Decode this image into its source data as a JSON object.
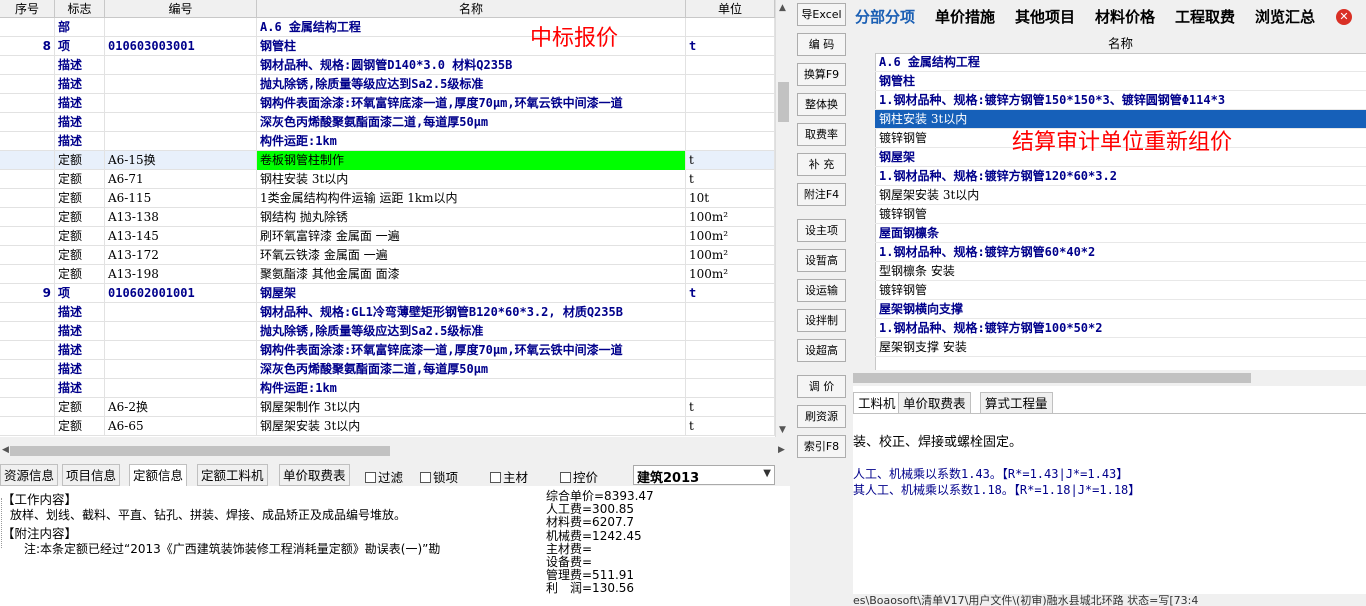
{
  "left": {
    "headers": {
      "seq": "序号",
      "flag": "标志",
      "code": "编号",
      "name": "名称",
      "unit": "单位"
    },
    "rows": [
      {
        "seq": "",
        "flag": "部",
        "code": "",
        "name": "A.6 金属结构工程",
        "unit": "",
        "style": "bold-blue"
      },
      {
        "seq": "8",
        "flag": "项",
        "code": "010603003001",
        "name": "钢管柱",
        "unit": "t",
        "style": "bold-blue"
      },
      {
        "seq": "",
        "flag": "描述",
        "code": "",
        "name": "钢材品种、规格:圆钢管D140*3.0 材料Q235B",
        "unit": "",
        "style": "bold-blue"
      },
      {
        "seq": "",
        "flag": "描述",
        "code": "",
        "name": "抛丸除锈,除质量等级应达到Sa2.5级标准",
        "unit": "",
        "style": "bold-blue"
      },
      {
        "seq": "",
        "flag": "描述",
        "code": "",
        "name": "钢构件表面涂漆:环氧富锌底漆一道,厚度70μm,环氧云铁中间漆一道",
        "unit": "",
        "style": "bold-blue"
      },
      {
        "seq": "",
        "flag": "描述",
        "code": "",
        "name": "深灰色丙烯酸聚氨酯面漆二道,每道厚50μm",
        "unit": "",
        "style": "bold-blue"
      },
      {
        "seq": "",
        "flag": "描述",
        "code": "",
        "name": "构件运距:1km",
        "unit": "",
        "style": "bold-blue"
      },
      {
        "seq": "",
        "flag": "定额",
        "code": "A6-15换",
        "name": "卷板钢管柱制作",
        "unit": "t",
        "style": "selected"
      },
      {
        "seq": "",
        "flag": "定额",
        "code": "A6-71",
        "name": "钢柱安装 3t以内",
        "unit": "t",
        "style": "normal"
      },
      {
        "seq": "",
        "flag": "定额",
        "code": "A6-115",
        "name": "1类金属结构构件运输 运距 1km以内",
        "unit": "10t",
        "style": "normal"
      },
      {
        "seq": "",
        "flag": "定额",
        "code": "A13-138",
        "name": "钢结构 抛丸除锈",
        "unit": "100m²",
        "style": "normal"
      },
      {
        "seq": "",
        "flag": "定额",
        "code": "A13-145",
        "name": "刷环氧富锌漆 金属面 一遍",
        "unit": "100m²",
        "style": "normal"
      },
      {
        "seq": "",
        "flag": "定额",
        "code": "A13-172",
        "name": "环氧云铁漆 金属面 一遍",
        "unit": "100m²",
        "style": "normal"
      },
      {
        "seq": "",
        "flag": "定额",
        "code": "A13-198",
        "name": "聚氨酯漆 其他金属面 面漆",
        "unit": "100m²",
        "style": "normal"
      },
      {
        "seq": "9",
        "flag": "项",
        "code": "010602001001",
        "name": "钢屋架",
        "unit": "t",
        "style": "bold-blue"
      },
      {
        "seq": "",
        "flag": "描述",
        "code": "",
        "name": "钢材品种、规格:GL1冷弯薄壁矩形钢管B120*60*3.2, 材质Q235B",
        "unit": "",
        "style": "bold-blue"
      },
      {
        "seq": "",
        "flag": "描述",
        "code": "",
        "name": "抛丸除锈,除质量等级应达到Sa2.5级标准",
        "unit": "",
        "style": "bold-blue"
      },
      {
        "seq": "",
        "flag": "描述",
        "code": "",
        "name": "钢构件表面涂漆:环氧富锌底漆一道,厚度70μm,环氧云铁中间漆一道",
        "unit": "",
        "style": "bold-blue"
      },
      {
        "seq": "",
        "flag": "描述",
        "code": "",
        "name": "深灰色丙烯酸聚氨酯面漆二道,每道厚50μm",
        "unit": "",
        "style": "bold-blue"
      },
      {
        "seq": "",
        "flag": "描述",
        "code": "",
        "name": "构件运距:1km",
        "unit": "",
        "style": "bold-blue"
      },
      {
        "seq": "",
        "flag": "定额",
        "code": "A6-2换",
        "name": "钢屋架制作 3t以内",
        "unit": "t",
        "style": "normal"
      },
      {
        "seq": "",
        "flag": "定额",
        "code": "A6-65",
        "name": "钢屋架安装 3t以内",
        "unit": "t",
        "style": "normal"
      }
    ],
    "annotation": "中标报价"
  },
  "buttons": [
    "导Excel",
    "编 码",
    "换算F9",
    "整体换",
    "取费率",
    "补 充",
    "附注F4",
    "设主项",
    "设暂高",
    "设运输",
    "设拌制",
    "设超高",
    "调 价",
    "刷资源",
    "索引F8"
  ],
  "bottom_tabs": [
    "资源信息",
    "项目信息",
    "定额信息",
    "定额工料机",
    "单价取费表"
  ],
  "checkboxes": [
    "过滤",
    "锁项",
    "主材",
    "控价"
  ],
  "dropdown": "建筑2013",
  "info": {
    "work_title": "【工作内容】",
    "work_text": "放样、划线、截料、平直、钻孔、拼装、焊接、成品矫正及成品编号堆放。",
    "note_title": "【附注内容】",
    "note_text": "注:本条定额已经过“2013《广西建筑装饰装修工程消耗量定额》勘误表(一)”勘",
    "costs": [
      "综合单价=8393.47",
      "人工费=300.85",
      "材料费=6207.7",
      "机械费=1242.45",
      "主材费=",
      "设备费=",
      "管理费=511.91",
      "利　润=130.56"
    ]
  },
  "right": {
    "tabs": [
      "分部分项",
      "单价措施",
      "其他项目",
      "材料价格",
      "工程取费",
      "浏览汇总"
    ],
    "header": "名称",
    "rows": [
      {
        "text": "A.6 金属结构工程",
        "style": "bold-blue"
      },
      {
        "text": "钢管柱",
        "style": "bold-blue"
      },
      {
        "text": "1.钢材品种、规格:镀锌方钢管150*150*3、镀锌圆钢管Φ114*3",
        "style": "bold-blue"
      },
      {
        "text": "钢柱安装 3t以内",
        "style": "selected"
      },
      {
        "text": "镀锌钢管",
        "style": "normal"
      },
      {
        "text": "钢屋架",
        "style": "bold-blue"
      },
      {
        "text": "1.钢材品种、规格:镀锌方钢管120*60*3.2",
        "style": "bold-blue"
      },
      {
        "text": "钢屋架安装 3t以内",
        "style": "normal"
      },
      {
        "text": "镀锌钢管",
        "style": "normal"
      },
      {
        "text": "屋面钢檩条",
        "style": "bold-blue"
      },
      {
        "text": "1.钢材品种、规格:镀锌方钢管60*40*2",
        "style": "bold-blue"
      },
      {
        "text": "型钢檩条 安装",
        "style": "normal"
      },
      {
        "text": "镀锌钢管",
        "style": "normal"
      },
      {
        "text": "屋架钢横向支撑",
        "style": "bold-blue"
      },
      {
        "text": "1.钢材品种、规格:镀锌方钢管100*50*2",
        "style": "bold-blue"
      },
      {
        "text": "屋架钢支撑 安装",
        "style": "normal"
      }
    ],
    "annotation": "结算审计单位重新组价",
    "sub_tabs": [
      "工料机",
      "单价取费表",
      "算式工程量"
    ],
    "detail_line1": "装、校正、焊接或螺栓固定。",
    "detail_line2": "人工、机械乘以系数1.43。【R*=1.43|J*=1.43】",
    "detail_line3": "其人工、机械乘以系数1.18。【R*=1.18|J*=1.18】",
    "status": "es\\Boaosoft\\清单V17\\用户文件\\(初审)融水县城北环路 状态=写[73:4"
  },
  "colors": {
    "accent": "#00008b",
    "selected_green": "#00ff00",
    "selected_blue": "#1660b9",
    "red_annotation": "#ff0000"
  }
}
